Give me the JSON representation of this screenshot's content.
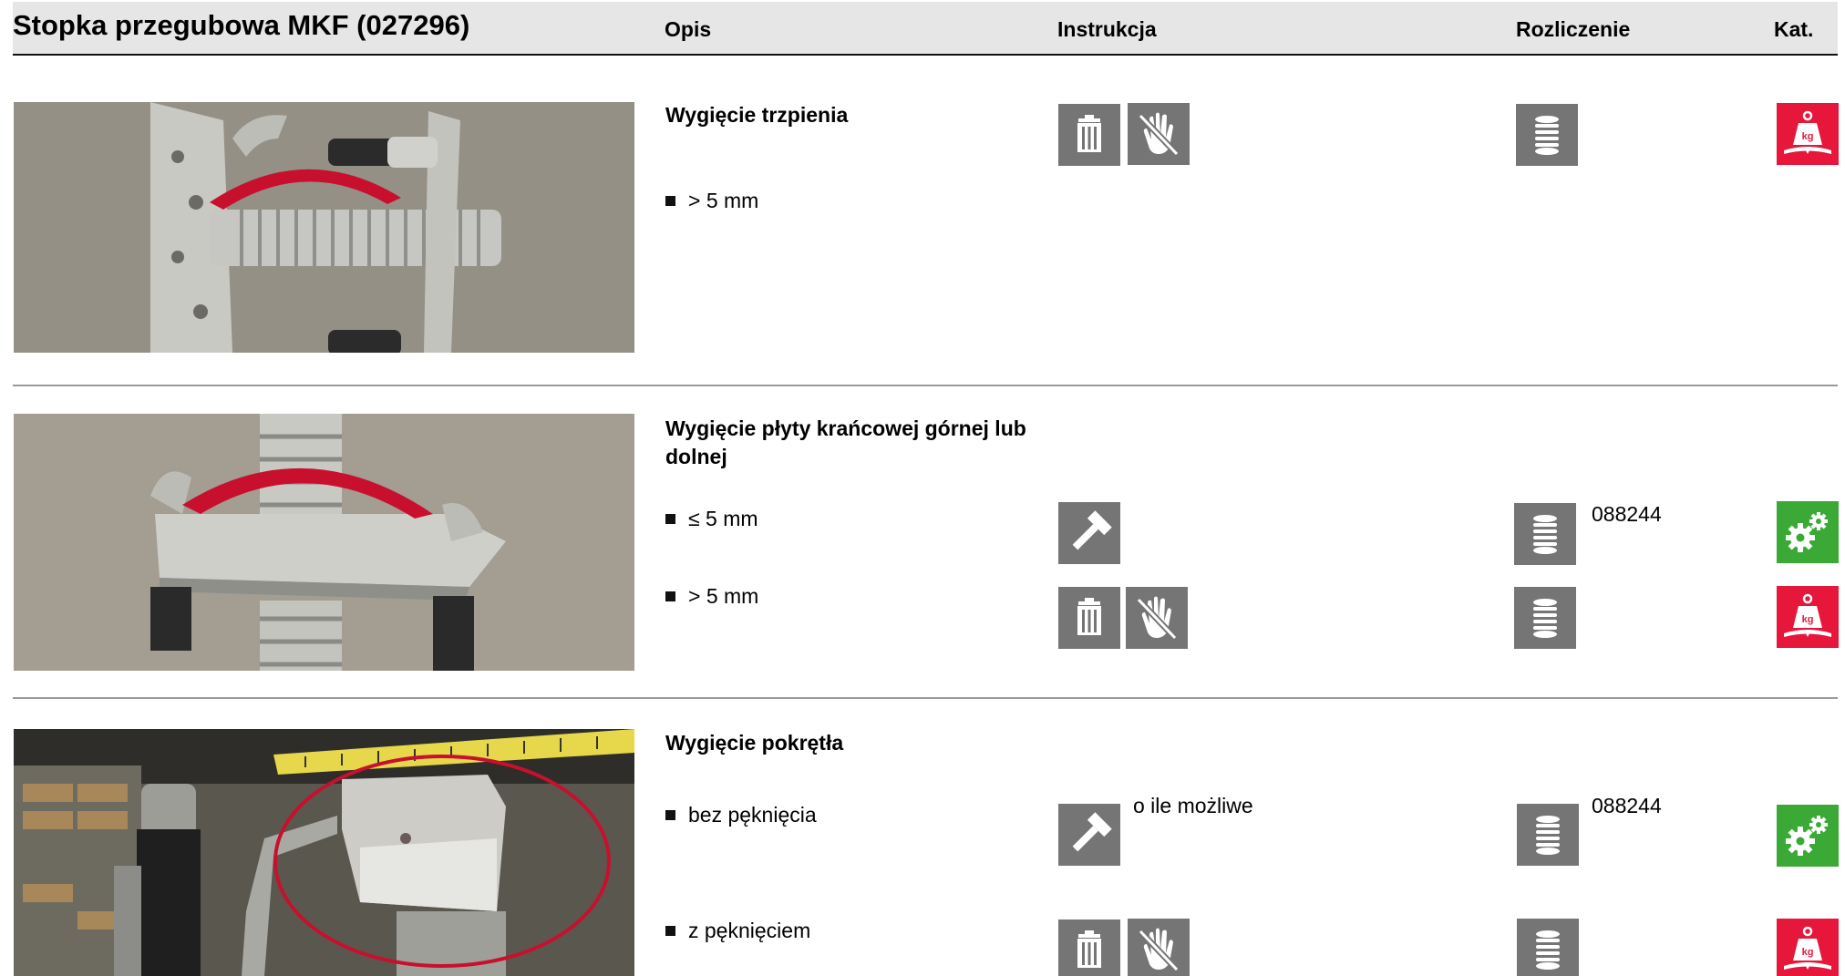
{
  "header": {
    "title": "Stopka przegubowa MKF (027296)",
    "columns": {
      "opis": "Opis",
      "instrukcja": "Instrukcja",
      "rozliczenie": "Rozliczenie",
      "kat": "Kat."
    }
  },
  "sections": [
    {
      "title": "Wygięcie trzpienia",
      "rows": [
        {
          "condition": "> 5 mm",
          "instruction_icons": [
            "trash-icon",
            "no-touch-hand-icon"
          ],
          "billing_icon": "stack-icon",
          "category_icon": "weight-kg-icon"
        }
      ]
    },
    {
      "title": "Wygięcie płyty krańcowej górnej lub dolnej",
      "rows": [
        {
          "condition": "≤ 5 mm",
          "instruction_icons": [
            "hammer-icon"
          ],
          "billing_icon": "stack-icon",
          "billing_code": "088244",
          "category_icon": "gears-icon"
        },
        {
          "condition": "> 5 mm",
          "instruction_icons": [
            "trash-icon",
            "no-touch-hand-icon"
          ],
          "billing_icon": "stack-icon",
          "category_icon": "weight-kg-icon"
        }
      ]
    },
    {
      "title": "Wygięcie pokrętła",
      "rows": [
        {
          "condition": "bez pęknięcia",
          "instruction_icons": [
            "hammer-icon"
          ],
          "instruction_note": "o ile możliwe",
          "billing_icon": "stack-icon",
          "billing_code": "088244",
          "category_icon": "gears-icon"
        },
        {
          "condition": "z pęknięciem",
          "instruction_icons": [
            "trash-icon",
            "no-touch-hand-icon"
          ],
          "billing_icon": "stack-icon",
          "category_icon": "weight-kg-icon"
        }
      ]
    }
  ],
  "colors": {
    "header_bg": "#e6e6e6",
    "icon_gray": "#757575",
    "icon_red": "#e6173a",
    "icon_green": "#3aa935",
    "marker_red": "#c8102e"
  },
  "weight_label": "kg"
}
